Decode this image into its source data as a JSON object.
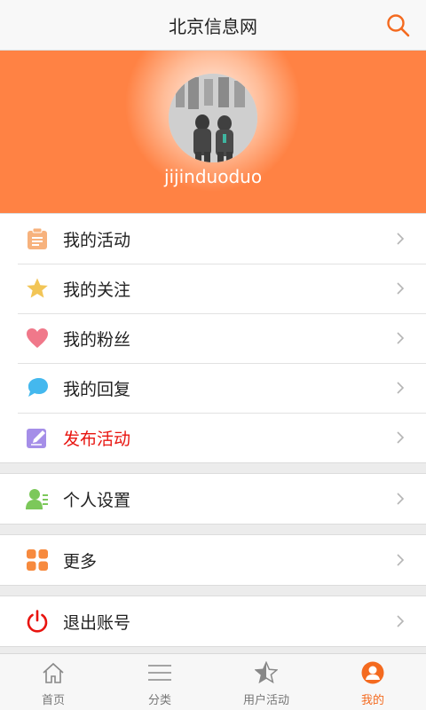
{
  "app": {
    "title": "北京信息网"
  },
  "icons": {
    "search": "search-icon"
  },
  "profile": {
    "username": "jijinduoduo"
  },
  "menu": {
    "group1": [
      {
        "label": "我的活动",
        "icon": "clipboard-icon"
      },
      {
        "label": "我的关注",
        "icon": "star-icon"
      },
      {
        "label": "我的粉丝",
        "icon": "heart-icon"
      },
      {
        "label": "我的回复",
        "icon": "chat-bubble-icon"
      },
      {
        "label": "发布活动",
        "icon": "edit-icon",
        "color": "#e8140f"
      }
    ],
    "group2": [
      {
        "label": "个人设置",
        "icon": "user-settings-icon"
      }
    ],
    "group3": [
      {
        "label": "更多",
        "icon": "grid-icon"
      }
    ],
    "group4": [
      {
        "label": "退出账号",
        "icon": "power-icon"
      }
    ]
  },
  "tabs": [
    {
      "label": "首页",
      "icon": "home-icon"
    },
    {
      "label": "分类",
      "icon": "list-icon"
    },
    {
      "label": "用户活动",
      "icon": "star-outline-icon"
    },
    {
      "label": "我的",
      "icon": "user-icon",
      "active": true
    }
  ],
  "colors": {
    "accent": "#ff8244",
    "active_tab": "#f46a1f",
    "danger": "#e8140f"
  }
}
